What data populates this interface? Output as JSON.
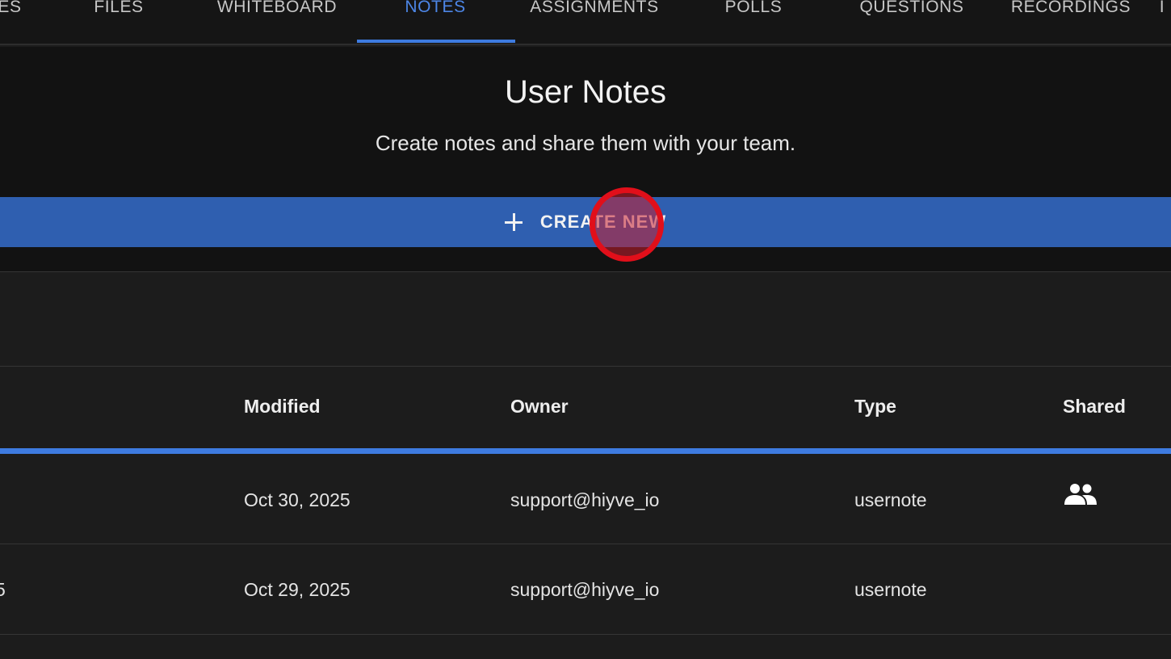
{
  "tabs": [
    {
      "label": "ES"
    },
    {
      "label": "FILES"
    },
    {
      "label": "WHITEBOARD"
    },
    {
      "label": "NOTES",
      "active": true
    },
    {
      "label": "ASSIGNMENTS"
    },
    {
      "label": "POLLS"
    },
    {
      "label": "QUESTIONS"
    },
    {
      "label": "RECORDINGS"
    },
    {
      "label": "I"
    }
  ],
  "header": {
    "title": "User Notes",
    "subtitle": "Create notes and share them with your team."
  },
  "create_button": {
    "label": "CREATE NEW",
    "icon": "plus-icon"
  },
  "table": {
    "columns": [
      "Modified",
      "Owner",
      "Type",
      "Shared"
    ],
    "rows": [
      {
        "title": "",
        "modified": "Oct 30, 2025",
        "owner": "support@hiyve_io",
        "type": "usernote",
        "shared": true,
        "shared_icon": "group-icon"
      },
      {
        "title": "5",
        "modified": "Oct 29, 2025",
        "owner": "support@hiyve_io",
        "type": "usernote",
        "shared": false
      }
    ]
  },
  "colors": {
    "accent": "#3e7be0",
    "button": "#2f5fb0",
    "click_marker": "#e10f1a"
  }
}
